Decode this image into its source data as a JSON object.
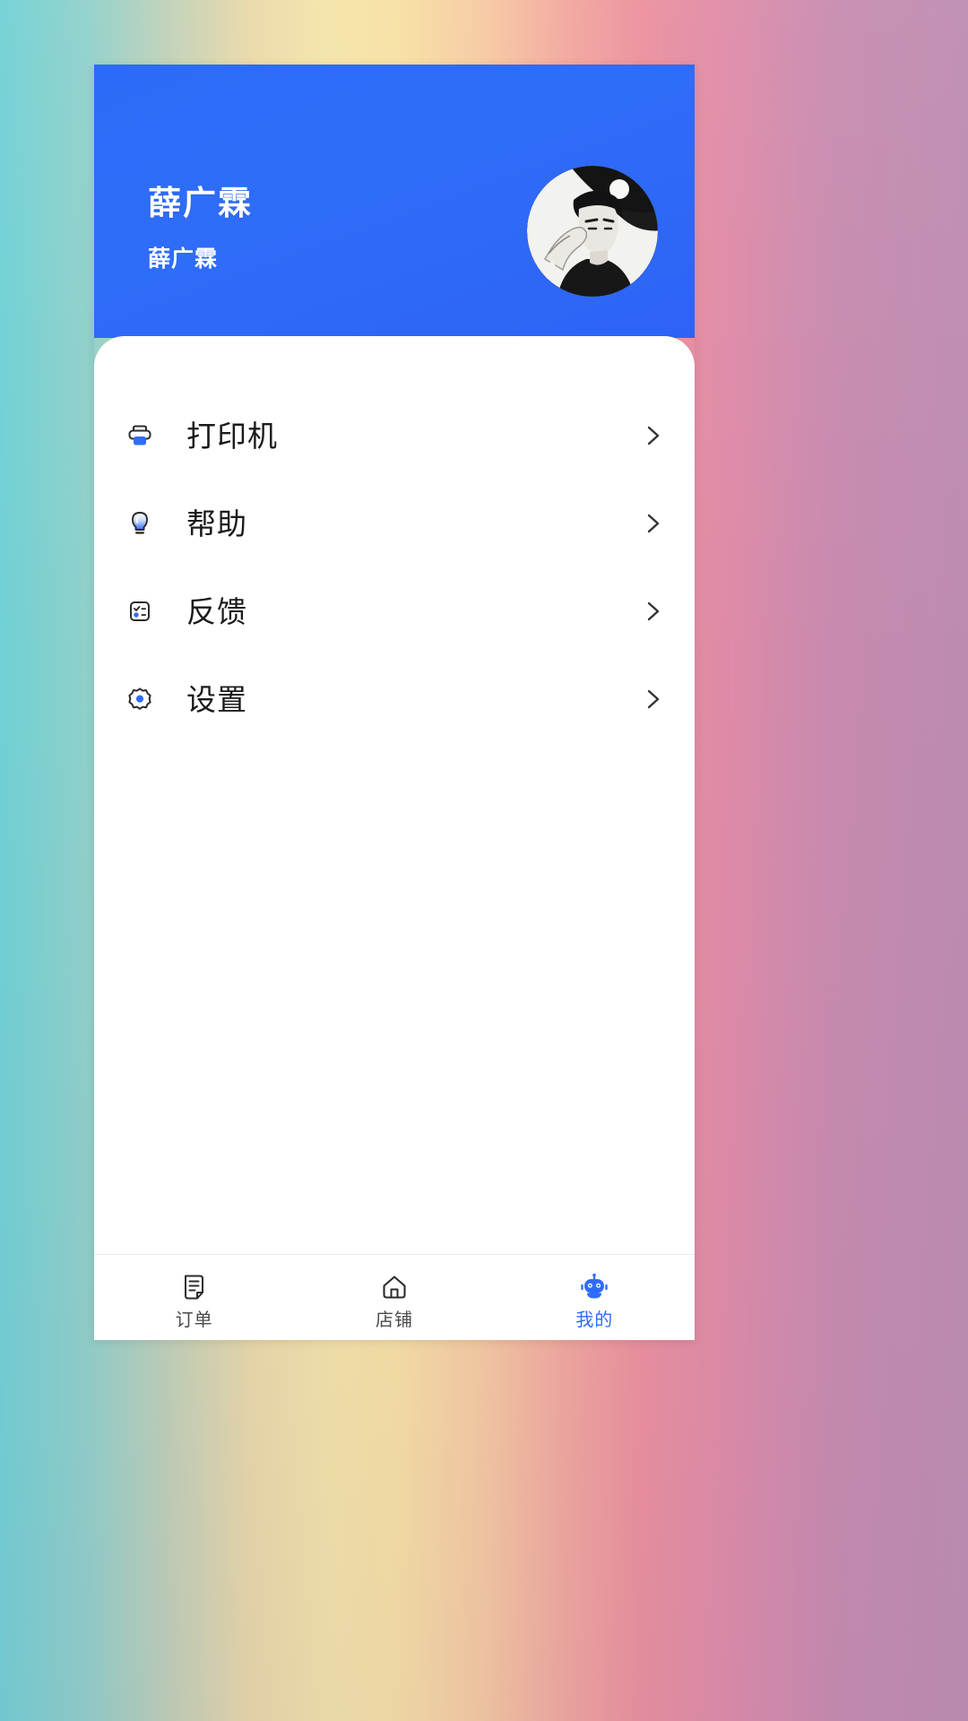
{
  "theme": {
    "header_blue": "#2f6df8",
    "accent_blue": "#2f6df8",
    "icon_dark": "#2b2b2b",
    "card_bg": "#ffffff",
    "text_primary": "#1b1b1b",
    "text_muted": "#4a4a4a",
    "background_gradient": [
      "#6fd0d4",
      "#f4e3a8",
      "#f2a89d",
      "#bd8bb0"
    ]
  },
  "profile": {
    "display_name": "薛广霖",
    "sub_name": "薛广霖",
    "avatar_icon": "avatar-portrait"
  },
  "menu": {
    "items": [
      {
        "id": "printer",
        "label": "打印机",
        "icon": "printer-icon",
        "chevron": "chevron-right-icon"
      },
      {
        "id": "help",
        "label": "帮助",
        "icon": "lightbulb-icon",
        "chevron": "chevron-right-icon"
      },
      {
        "id": "feedback",
        "label": "反馈",
        "icon": "checklist-icon",
        "chevron": "chevron-right-icon"
      },
      {
        "id": "settings",
        "label": "设置",
        "icon": "gear-icon",
        "chevron": "chevron-right-icon"
      }
    ]
  },
  "tabbar": {
    "items": [
      {
        "id": "orders",
        "label": "订单",
        "icon": "order-list-icon",
        "active": false
      },
      {
        "id": "shop",
        "label": "店铺",
        "icon": "home-icon",
        "active": false
      },
      {
        "id": "mine",
        "label": "我的",
        "icon": "robot-user-icon",
        "active": true
      }
    ]
  }
}
